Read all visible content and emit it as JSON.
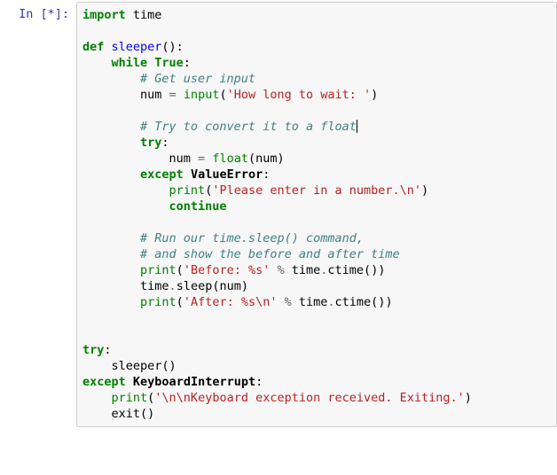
{
  "prompt": {
    "prefix": "In ",
    "counter": "[*]",
    "suffix": ":"
  },
  "lines": {
    "l1_import": "import",
    "l1_mod": " time",
    "blank": "",
    "l3_def": "def",
    "l3_name": " sleeper",
    "l3_paren": "():",
    "l4_while": "    while",
    "l4_true": " True",
    "l4_colon": ":",
    "l5_c": "        # Get user input",
    "l6_a": "        num ",
    "l6_op": "=",
    "l6_sp": " ",
    "l6_inp": "input",
    "l6_p1": "(",
    "l6_s": "'How long to wait: '",
    "l6_p2": ")",
    "l8_c": "        # Try to convert it to a float",
    "l9_try": "        try",
    "l9_colon": ":",
    "l10_a": "            num ",
    "l10_op": "=",
    "l10_sp": " ",
    "l10_fl": "float",
    "l10_p1": "(num)",
    "l11_exc": "        except",
    "l11_sp": " ",
    "l11_ve": "ValueError",
    "l11_colon": ":",
    "l12_ind": "            ",
    "l12_pr": "print",
    "l12_p1": "(",
    "l12_s": "'Please enter in a number.\\n'",
    "l12_p2": ")",
    "l13_cont": "            continue",
    "l15_c": "        # Run our time.sleep() command,",
    "l16_c": "        # and show the before and after time",
    "l17_ind": "        ",
    "l17_pr": "print",
    "l17_p1": "(",
    "l17_s": "'Before: %s'",
    "l17_sp": " ",
    "l17_op": "%",
    "l17_t": " time",
    "l17_dot": ".",
    "l17_ct": "ctime())",
    "l18_a": "        time",
    "l18_dot": ".",
    "l18_sl": "sleep(num)",
    "l19_ind": "        ",
    "l19_pr": "print",
    "l19_p1": "(",
    "l19_s": "'After: %s\\n'",
    "l19_sp": " ",
    "l19_op": "%",
    "l19_t": " time",
    "l19_dot": ".",
    "l19_ct": "ctime())",
    "l22_try": "try",
    "l22_colon": ":",
    "l23_call": "    sleeper()",
    "l24_exc": "except",
    "l24_sp": " ",
    "l24_ki": "KeyboardInterrupt",
    "l24_colon": ":",
    "l25_ind": "    ",
    "l25_pr": "print",
    "l25_p1": "(",
    "l25_s": "'\\n\\nKeyboard exception received. Exiting.'",
    "l25_p2": ")",
    "l26_ind": "    ",
    "l26_ex": "exit()"
  }
}
